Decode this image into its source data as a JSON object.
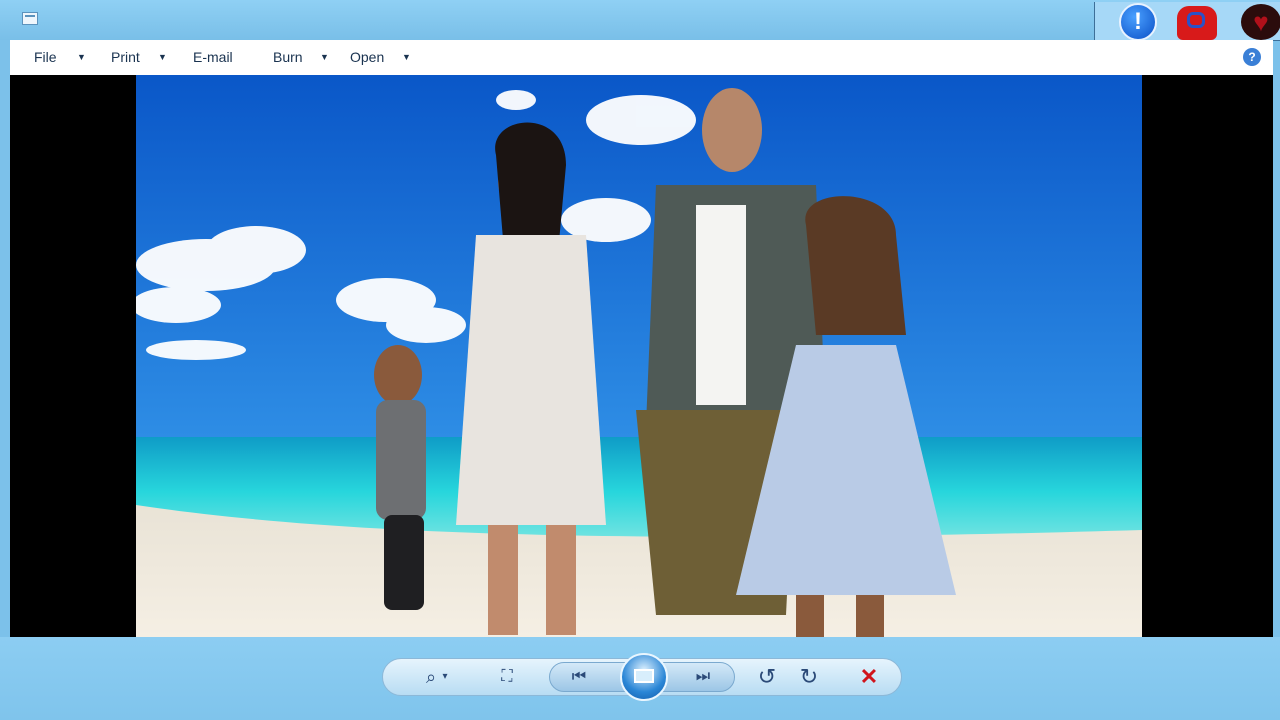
{
  "menu": {
    "file": "File",
    "print": "Print",
    "email": "E-mail",
    "burn": "Burn",
    "open": "Open"
  },
  "icons": {
    "app": "photo-viewer-icon",
    "alert": "alert-icon",
    "backpack": "backpack-icon",
    "heart": "heart-icon",
    "help": "help-icon",
    "zoom": "zoom-icon",
    "actual_size": "actual-size-icon",
    "previous": "previous-icon",
    "slideshow": "slideshow-icon",
    "next": "next-icon",
    "rotate_ccw": "rotate-counterclockwise-icon",
    "rotate_cw": "rotate-clockwise-icon",
    "delete": "delete-icon"
  },
  "glyphs": {
    "alert": "!",
    "heart": "♥",
    "help": "?",
    "zoom": "⌕",
    "zoom_arrow": "▾",
    "actual_size": "⛶",
    "previous": "⏮",
    "next": "⏭",
    "rotate_ccw": "↺",
    "rotate_cw": "↻",
    "delete": "✕",
    "menu_arrow": "▼"
  },
  "colors": {
    "chrome": "#7cc1ea",
    "menu_background": "#ffffff",
    "viewer_background": "#000000",
    "delete": "#d0141c"
  }
}
